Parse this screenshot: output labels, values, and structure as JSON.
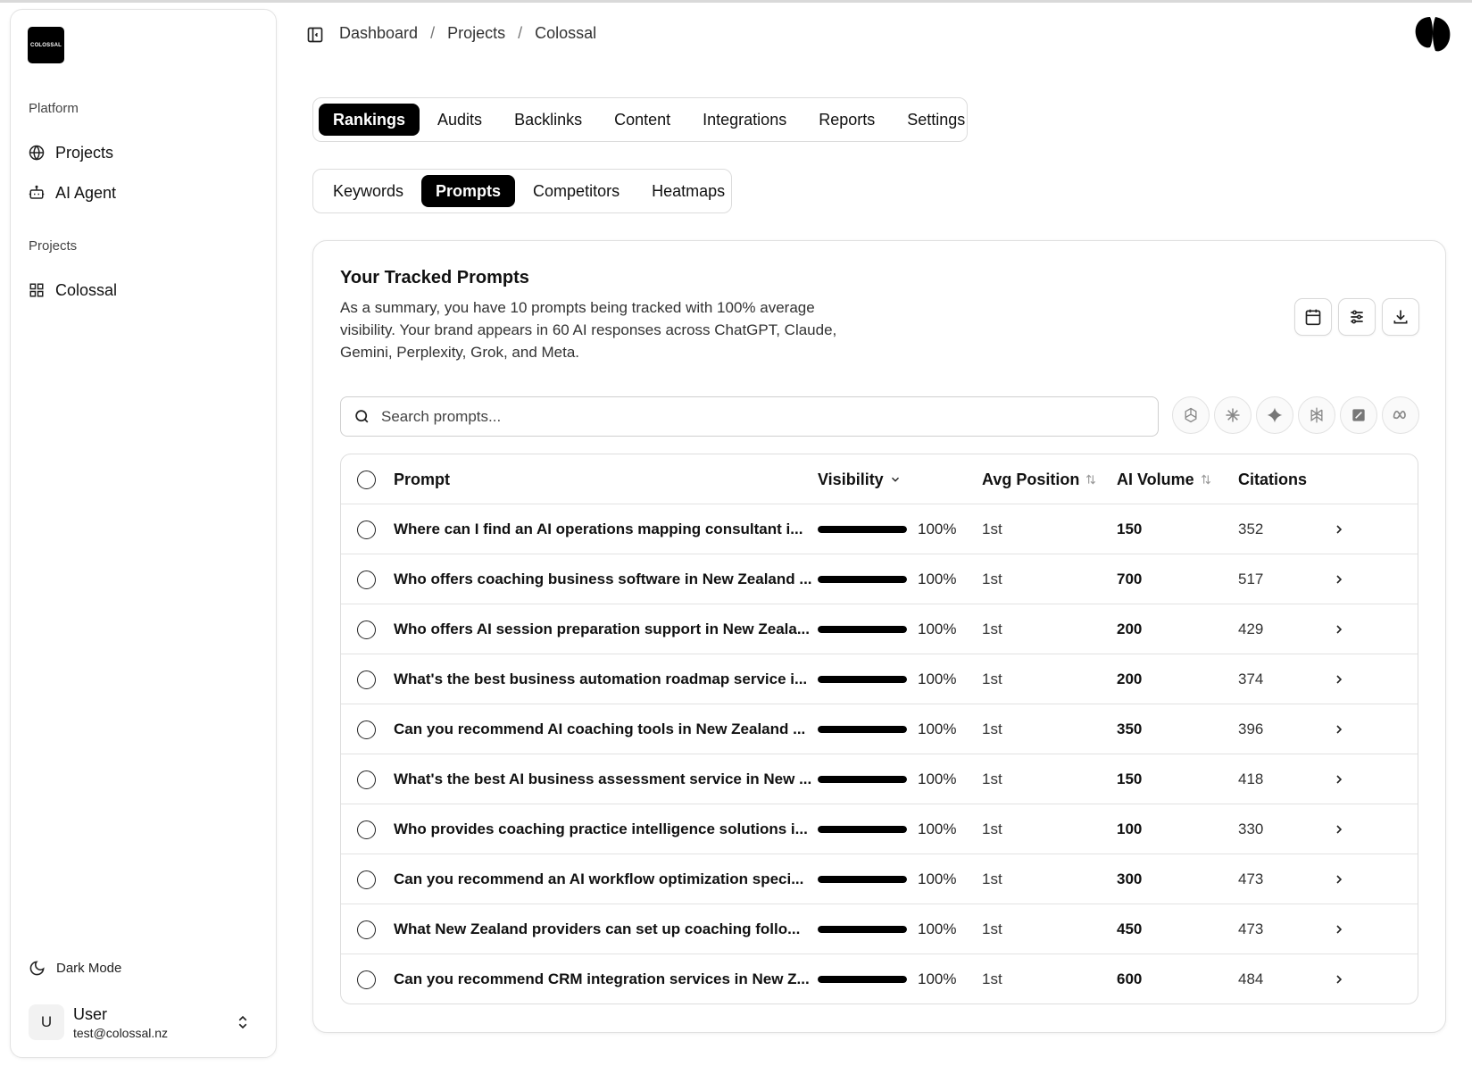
{
  "sidebar": {
    "logo_text": "COLOSSAL",
    "platform_label": "Platform",
    "platform_items": [
      {
        "label": "Projects",
        "icon": "globe-icon"
      },
      {
        "label": "AI Agent",
        "icon": "bot-icon"
      }
    ],
    "projects_label": "Projects",
    "project_items": [
      {
        "label": "Colossal",
        "icon": "grid-icon"
      }
    ],
    "dark_mode_label": "Dark Mode",
    "user": {
      "initial": "U",
      "name": "User",
      "email": "test@colossal.nz"
    }
  },
  "header": {
    "breadcrumb": [
      "Dashboard",
      "Projects",
      "Colossal"
    ],
    "separator": "/"
  },
  "main_tabs": [
    "Rankings",
    "Audits",
    "Backlinks",
    "Content",
    "Integrations",
    "Reports",
    "Settings"
  ],
  "main_tab_active": "Rankings",
  "sub_tabs": [
    "Keywords",
    "Prompts",
    "Competitors",
    "Heatmaps"
  ],
  "sub_tab_active": "Prompts",
  "card": {
    "title": "Your Tracked Prompts",
    "description": "As a summary, you have 10 prompts being tracked with 100% average visibility. Your brand appears in 60 AI responses across ChatGPT, Claude, Gemini, Perplexity, Grok, and Meta.",
    "actions": [
      "calendar-icon",
      "filter-sliders-icon",
      "download-icon"
    ],
    "search_placeholder": "Search prompts...",
    "search_value": "",
    "model_filters": [
      "chatgpt-icon",
      "claude-icon",
      "gemini-icon",
      "perplexity-icon",
      "grok-icon",
      "meta-icon"
    ]
  },
  "table": {
    "headers": {
      "prompt": "Prompt",
      "visibility": "Visibility",
      "avg_position": "Avg Position",
      "ai_volume": "AI Volume",
      "citations": "Citations"
    },
    "rows": [
      {
        "prompt": "Where can I find an AI operations mapping consultant i...",
        "visibility": 1.0,
        "visibility_label": "100%",
        "position": "1st",
        "volume": "150",
        "citations": "352"
      },
      {
        "prompt": "Who offers coaching business software in New Zealand ...",
        "visibility": 1.0,
        "visibility_label": "100%",
        "position": "1st",
        "volume": "700",
        "citations": "517"
      },
      {
        "prompt": "Who offers AI session preparation support in New Zeala...",
        "visibility": 1.0,
        "visibility_label": "100%",
        "position": "1st",
        "volume": "200",
        "citations": "429"
      },
      {
        "prompt": "What's the best business automation roadmap service i...",
        "visibility": 1.0,
        "visibility_label": "100%",
        "position": "1st",
        "volume": "200",
        "citations": "374"
      },
      {
        "prompt": "Can you recommend AI coaching tools in New Zealand ...",
        "visibility": 1.0,
        "visibility_label": "100%",
        "position": "1st",
        "volume": "350",
        "citations": "396"
      },
      {
        "prompt": "What's the best AI business assessment service in New ...",
        "visibility": 1.0,
        "visibility_label": "100%",
        "position": "1st",
        "volume": "150",
        "citations": "418"
      },
      {
        "prompt": "Who provides coaching practice intelligence solutions i...",
        "visibility": 1.0,
        "visibility_label": "100%",
        "position": "1st",
        "volume": "100",
        "citations": "330"
      },
      {
        "prompt": "Can you recommend an AI workflow optimization speci...",
        "visibility": 1.0,
        "visibility_label": "100%",
        "position": "1st",
        "volume": "300",
        "citations": "473"
      },
      {
        "prompt": "What New Zealand providers can set up coaching follo...",
        "visibility": 1.0,
        "visibility_label": "100%",
        "position": "1st",
        "volume": "450",
        "citations": "473"
      },
      {
        "prompt": "Can you recommend CRM integration services in New Z...",
        "visibility": 1.0,
        "visibility_label": "100%",
        "position": "1st",
        "volume": "600",
        "citations": "484"
      }
    ]
  },
  "colors": {
    "accent": "#000000",
    "border": "#e0e0e0",
    "bar_track": "#e6e6e6"
  }
}
